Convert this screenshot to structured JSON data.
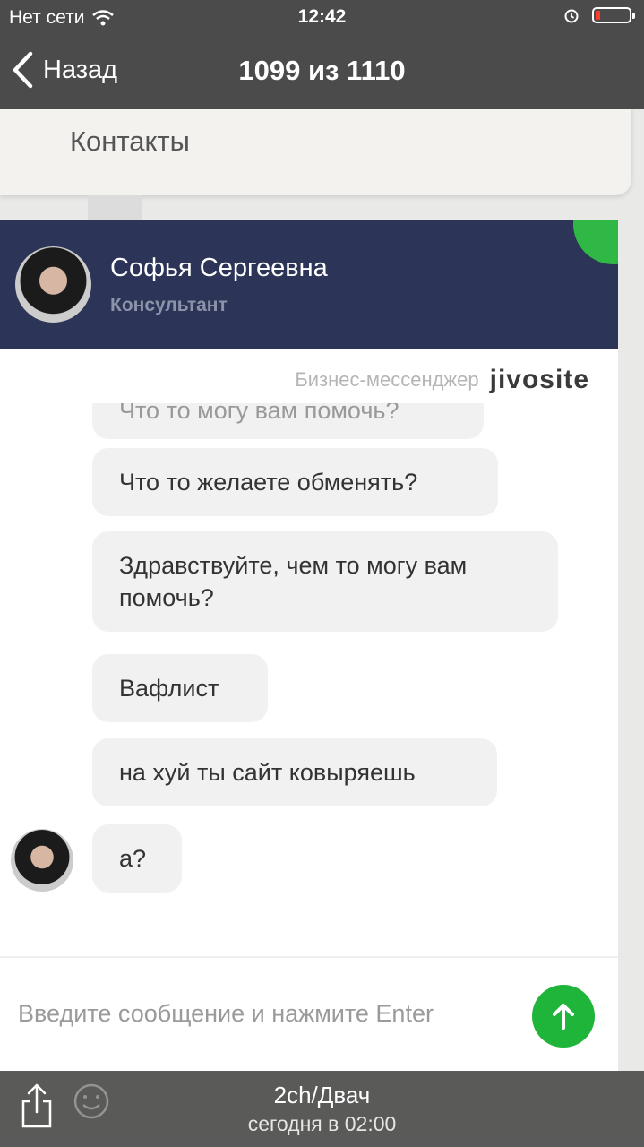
{
  "status_bar": {
    "carrier": "Нет сети",
    "time": "12:42"
  },
  "nav": {
    "back_label": "Назад",
    "title": "1099 из 1110"
  },
  "page": {
    "contacts_label": "Контакты"
  },
  "chat": {
    "agent_name": "Софья Сергеевна",
    "agent_role": "Консультант",
    "branding_text": "Бизнес-мессенджер",
    "branding_logo": "jivosite",
    "messages": [
      "Что то могу вам помочь?",
      "Что то желаете обменять?",
      "Здравствуйте, чем то могу вам помочь?",
      "Вафлист",
      "на хуй ты сайт ковыряешь",
      "а?"
    ],
    "input_placeholder": "Введите сообщение и нажмите Enter",
    "accent_color": "#2fb845",
    "header_color": "#2c3557"
  },
  "bottom_bar": {
    "title": "2ch/Двач",
    "subtitle": "сегодня в 02:00"
  }
}
